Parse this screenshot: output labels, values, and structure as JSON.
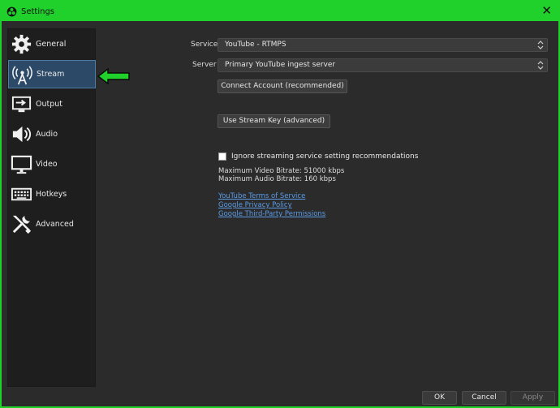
{
  "window": {
    "title": "Settings",
    "close_glyph": "✕"
  },
  "sidebar": {
    "items": [
      {
        "label": "General",
        "icon": "gear-icon"
      },
      {
        "label": "Stream",
        "icon": "antenna-icon",
        "active": true
      },
      {
        "label": "Output",
        "icon": "output-icon"
      },
      {
        "label": "Audio",
        "icon": "speaker-icon"
      },
      {
        "label": "Video",
        "icon": "monitor-icon"
      },
      {
        "label": "Hotkeys",
        "icon": "keyboard-icon"
      },
      {
        "label": "Advanced",
        "icon": "tools-icon"
      }
    ]
  },
  "stream": {
    "service_label": "Service",
    "service_value": "YouTube - RTMPS",
    "server_label": "Server",
    "server_value": "Primary YouTube ingest server",
    "connect_button": "Connect Account (recommended)",
    "stream_key_button": "Use Stream Key (advanced)",
    "ignore_checkbox_label": "Ignore streaming service setting recommendations",
    "max_video_bitrate": "Maximum Video Bitrate: 51000 kbps",
    "max_audio_bitrate": "Maximum Audio Bitrate: 160 kbps",
    "links": [
      "YouTube Terms of Service",
      "Google Privacy Policy",
      "Google Third-Party Permissions"
    ]
  },
  "footer": {
    "ok": "OK",
    "cancel": "Cancel",
    "apply": "Apply"
  },
  "colors": {
    "accent": "#1fd12a",
    "active_item": "#2c4a67",
    "link": "#5b9ce8"
  }
}
